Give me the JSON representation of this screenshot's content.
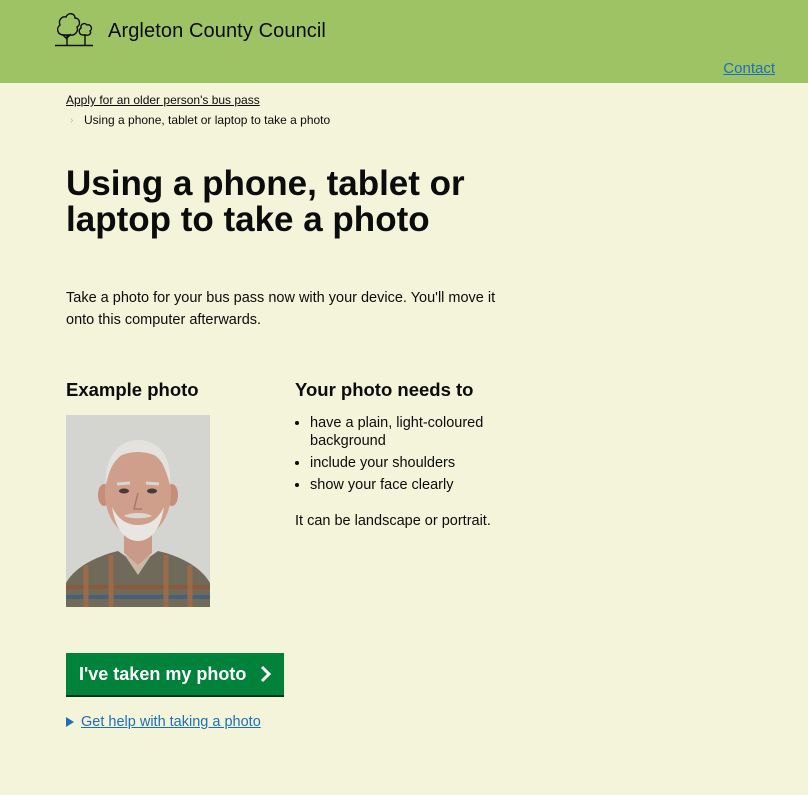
{
  "header": {
    "site_name": "Argleton County Council",
    "logo_icon": "trees-icon",
    "contact_label": "Contact",
    "background_color": "#9ec365"
  },
  "breadcrumb": {
    "parent_label": "Apply for an older person's bus pass",
    "current_label": "Using a phone, tablet or laptop to take a photo"
  },
  "page": {
    "title": "Using a phone, tablet or laptop to take a photo",
    "intro": "Take a photo for your bus pass now with your device. You'll move it onto this computer afterwards."
  },
  "example": {
    "heading": "Example photo"
  },
  "requirements": {
    "heading": "Your photo needs to",
    "items": [
      "have a plain, light-coloured background",
      "include your shoulders",
      "show your face clearly"
    ],
    "note": "It can be landscape or portrait."
  },
  "actions": {
    "primary_label": "I've taken my photo",
    "help_label": "Get help with taking a photo",
    "primary_color": "#00823b",
    "link_color": "#1d70b8"
  }
}
